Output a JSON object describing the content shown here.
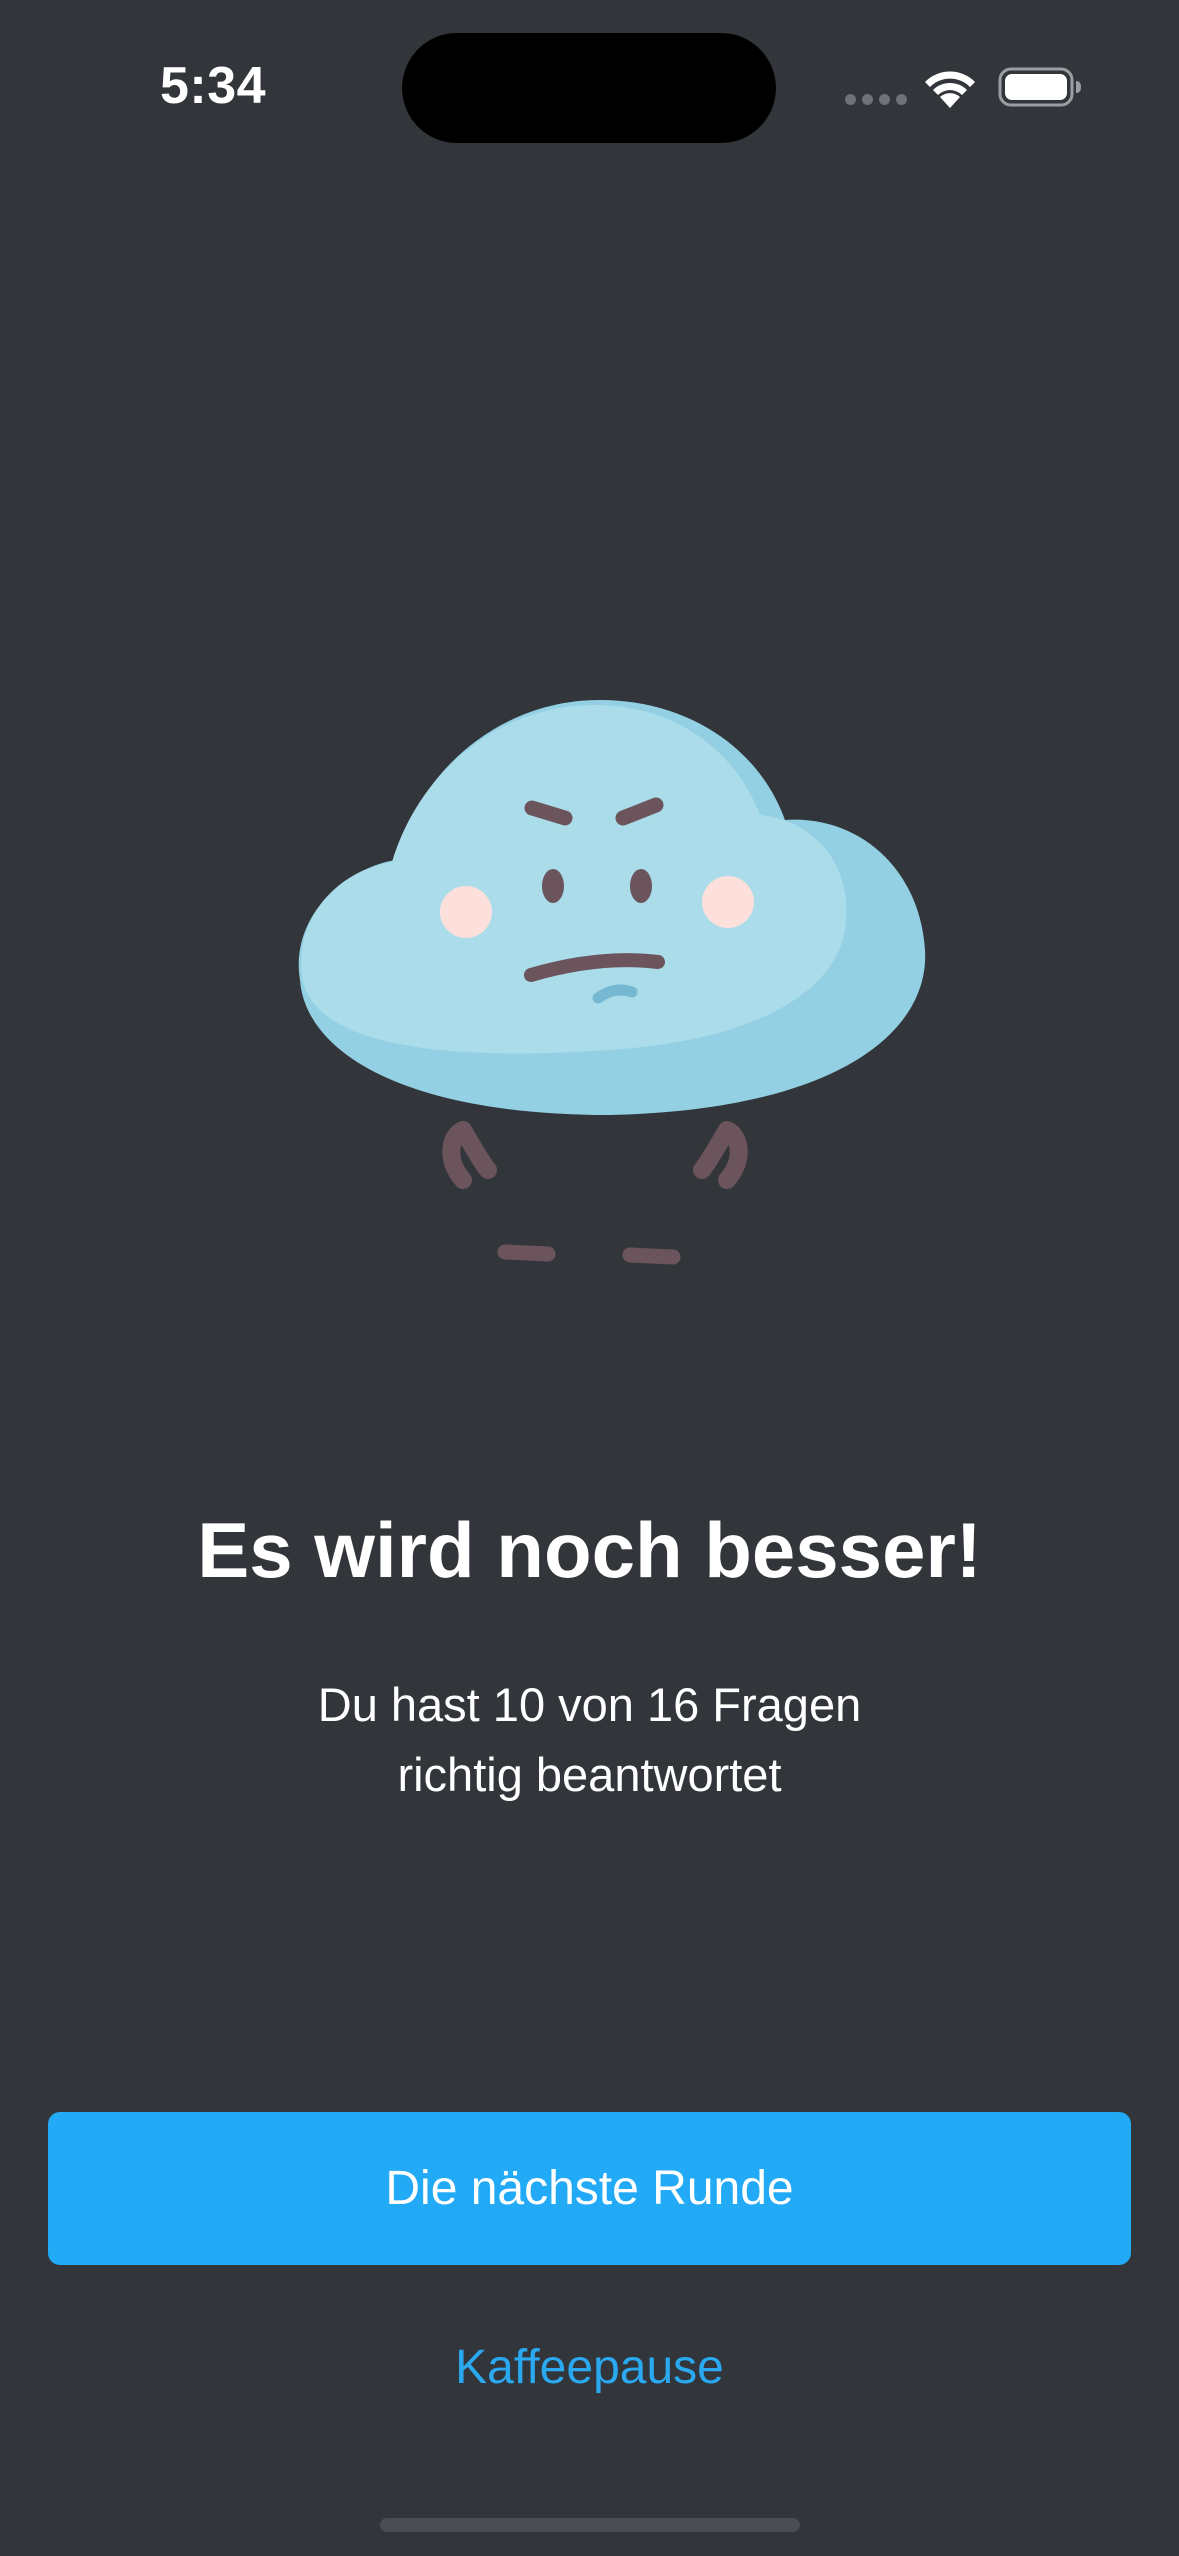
{
  "status_bar": {
    "time": "5:34"
  },
  "result": {
    "title": "Es wird noch besser!",
    "subtitle_line1": "Du hast 10 von 16 Fragen",
    "subtitle_line2": "richtig beantwortet",
    "correct": 10,
    "total": 16
  },
  "actions": {
    "primary_label": "Die nächste Runde",
    "secondary_label": "Kaffeepause"
  },
  "icons": {
    "mascot": "grumpy-cloud-icon",
    "wifi": "wifi-icon",
    "battery": "battery-icon",
    "signal": "cellular-signal-icon"
  },
  "colors": {
    "background": "#32363b",
    "accent": "#22aaf7",
    "link": "#2aa8f0",
    "cloud": "#abdcea",
    "cloud_shadow": "#93d0e4",
    "face": "#6b545b",
    "cheeks": "#fde0dc"
  }
}
